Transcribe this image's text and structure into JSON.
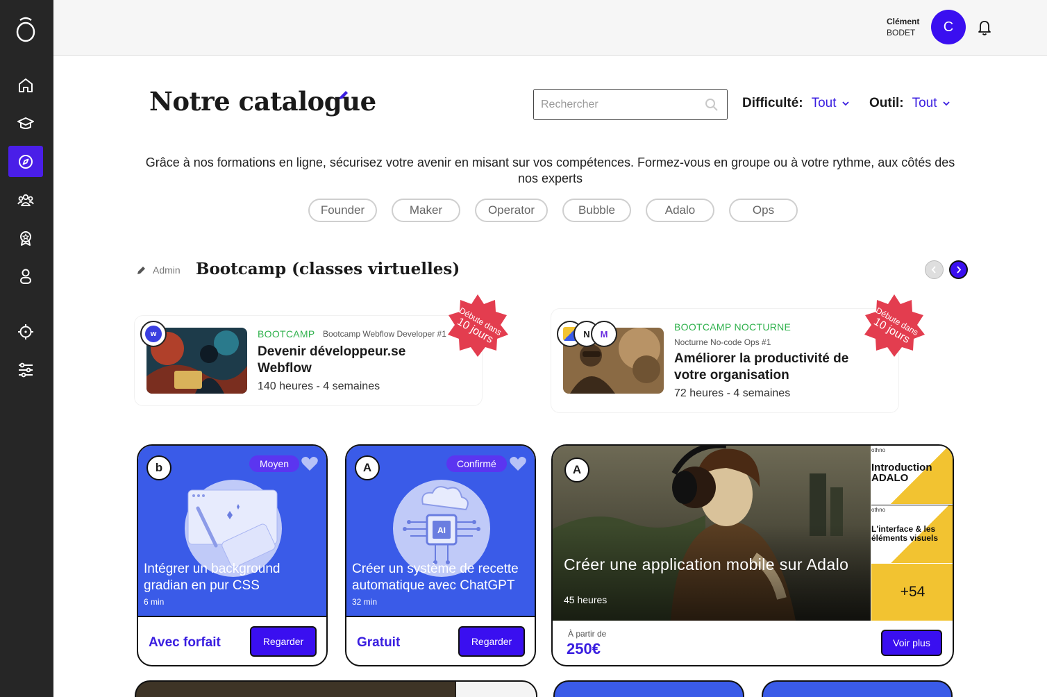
{
  "user": {
    "first_name": "Clément",
    "last_name": "BODET",
    "initial": "C"
  },
  "page": {
    "title": "Notre catalogue",
    "search_placeholder": "Rechercher",
    "difficulty_label": "Difficulté:",
    "difficulty_value": "Tout",
    "tool_label": "Outil:",
    "tool_value": "Tout",
    "intro": "Grâce à nos formations en ligne, sécurisez votre avenir en misant sur vos compétences. Formez-vous en groupe ou à votre rythme, aux côtés des nos experts",
    "chips": [
      "Founder",
      "Maker",
      "Operator",
      "Bubble",
      "Adalo",
      "Ops"
    ]
  },
  "section": {
    "admin_label": "Admin",
    "title": "Bootcamp (classes virtuelles)"
  },
  "bootcamps": [
    {
      "kind": "BOOTCAMP",
      "subtitle": "Bootcamp Webflow Developer #1",
      "title": "Devenir développeur.se Webflow",
      "meta": "140 heures - 4 semaines",
      "badge_top": "Débute dans",
      "badge_bottom": "10 jours",
      "tool_letter": "w"
    },
    {
      "kind": "BOOTCAMP NOCTURNE",
      "subtitle": "Nocturne No-code Ops #1",
      "title": "Améliorer la productivité de votre organisation",
      "meta": "72 heures - 4 semaines",
      "badge_top": "Débute dans",
      "badge_bottom": "10 jours",
      "tool_letters": [
        "",
        "N",
        "M"
      ]
    }
  ],
  "courses": [
    {
      "logo": "b",
      "level": "Moyen",
      "title": "Intégrer un background gradian en pur CSS",
      "duration": "6 min",
      "price": "Avec forfait",
      "button": "Regarder"
    },
    {
      "logo": "A",
      "level": "Confirmé",
      "title": "Créer un système de recette automatique avec ChatGPT",
      "duration": "32 min",
      "price": "Gratuit",
      "button": "Regarder",
      "chip_label": "AI"
    }
  ],
  "featured": {
    "logo": "A",
    "title": "Créer une application mobile sur Adalo",
    "duration": "45 heures",
    "thumbs": [
      {
        "brand": "othno",
        "text": "Introduction ADALO"
      },
      {
        "brand": "othno",
        "text": "L'interface & les éléments visuels"
      }
    ],
    "more": "+54",
    "from_label": "À partir de",
    "price": "250€",
    "button": "Voir plus"
  },
  "colors": {
    "accent": "#3a0ff0",
    "sidebar": "#262626",
    "card_blue": "#3a5be8",
    "green": "#2fb14c",
    "badge_red": "#e33d4f"
  },
  "icons": [
    "logo-icon",
    "home-icon",
    "graduation-cap-icon",
    "compass-icon",
    "community-icon",
    "badge-icon",
    "user-icon",
    "target-icon",
    "settings-sliders-icon",
    "bell-icon",
    "search-icon",
    "chevron-down-icon",
    "pencil-icon",
    "heart-icon",
    "chevron-left-icon",
    "chevron-right-icon"
  ]
}
